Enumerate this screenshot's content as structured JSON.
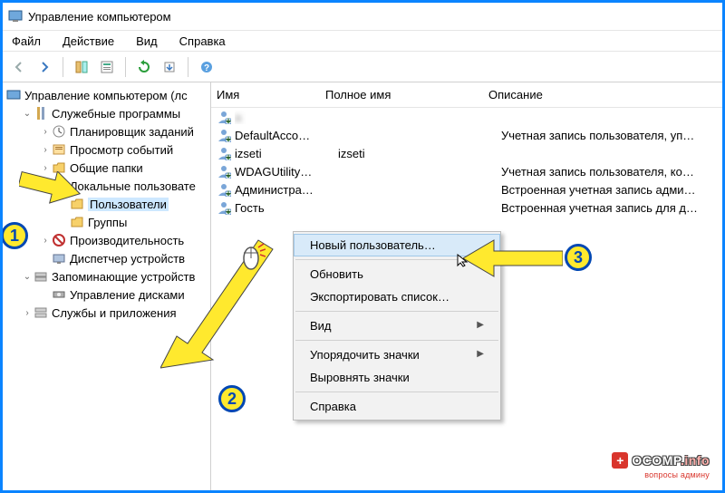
{
  "window": {
    "title": "Управление компьютером"
  },
  "menu": {
    "file": "Файл",
    "action": "Действие",
    "view": "Вид",
    "help": "Справка"
  },
  "tree": {
    "root": "Управление компьютером (лс",
    "svc": "Служебные программы",
    "sched": "Планировщик заданий",
    "events": "Просмотр событий",
    "shared": "Общие папки",
    "local": "Локальные пользовате",
    "users": "Пользователи",
    "groups": "Группы",
    "perf": "Производительность",
    "devmgr": "Диспетчер устройств",
    "storage": "Запоминающие устройств",
    "diskmgr": "Управление дисками",
    "services": "Службы и приложения"
  },
  "list": {
    "headers": {
      "name": "Имя",
      "fullname": "Полное имя",
      "desc": "Описание"
    },
    "rows": [
      {
        "name": "a",
        "fullname": "",
        "desc": "",
        "blurred": true
      },
      {
        "name": "DefaultAcco…",
        "fullname": "",
        "desc": "Учетная запись пользователя, уп…"
      },
      {
        "name": "izseti",
        "fullname": "izseti",
        "desc": ""
      },
      {
        "name": "WDAGUtility…",
        "fullname": "",
        "desc": "Учетная запись пользователя, ко…"
      },
      {
        "name": "Администра…",
        "fullname": "",
        "desc": "Встроенная учетная запись адми…"
      },
      {
        "name": "Гость",
        "fullname": "",
        "desc": "Встроенная учетная запись для д…"
      }
    ]
  },
  "context": {
    "new_user": "Новый пользователь…",
    "refresh": "Обновить",
    "export": "Экспортировать список…",
    "view": "Вид",
    "arrange": "Упорядочить значки",
    "align": "Выровнять значки",
    "help": "Справка"
  },
  "callouts": {
    "c1": "1",
    "c2": "2",
    "c3": "3"
  },
  "watermark": {
    "main": "OCOMP",
    "suffix": ".info",
    "sub": "вопросы админу"
  }
}
